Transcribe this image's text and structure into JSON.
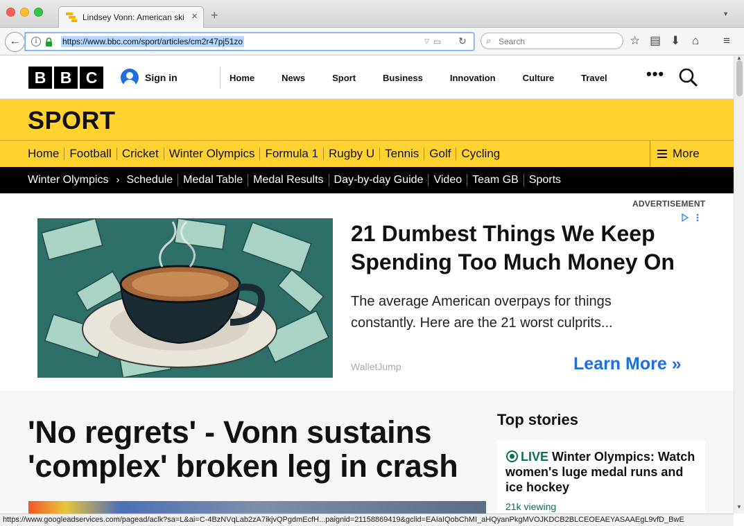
{
  "browser": {
    "tab_title": "Lindsey Vonn: American ski",
    "url": "https://www.bbc.com/sport/articles/cm2r47pj51zo",
    "search_placeholder": "Search",
    "status_url": "https://www.googleadservices.com/pagead/aclk?sa=L&ai=C-4BzNVqLab2zA7ikjvQPgdmEcfH...paignid=21158869419&gclid=EAIaIQobChMI_aHQyanPkgMVOJKDCB2BLCEOEAEYASAAEgL9vfD_BwE"
  },
  "masthead": {
    "logo_letters": [
      "B",
      "B",
      "C"
    ],
    "sign_in": "Sign in",
    "nav": [
      "Home",
      "News",
      "Sport",
      "Business",
      "Innovation",
      "Culture",
      "Travel"
    ],
    "more": "•••"
  },
  "sport": {
    "title": "SPORT",
    "nav": [
      "Home",
      "Football",
      "Cricket",
      "Winter Olympics",
      "Formula 1",
      "Rugby U",
      "Tennis",
      "Golf",
      "Cycling"
    ],
    "more_label": "More",
    "subnav_section": "Winter Olympics",
    "subnav": [
      "Schedule",
      "Medal Table",
      "Medal Results",
      "Day-by-day Guide",
      "Video",
      "Team GB",
      "Sports"
    ]
  },
  "ad": {
    "label": "ADVERTISEMENT",
    "headline": "21 Dumbest Things We Keep Spending Too Much Money On",
    "body": "The average American overpays for things constantly. Here are the 21 worst culprits...",
    "source": "WalletJump",
    "cta": "Learn More »"
  },
  "article": {
    "headline": "'No regrets' - Vonn sustains 'complex' broken leg in crash"
  },
  "top_stories": {
    "title": "Top stories",
    "items": [
      {
        "live": "LIVE",
        "text": "Winter Olympics: Watch women's luge medal runs and ice hockey",
        "viewers": "21k viewing"
      }
    ]
  },
  "colors": {
    "sport_yellow": "#ffd230",
    "live_green": "#0a6e5a",
    "cta_blue": "#1c6fdc"
  }
}
